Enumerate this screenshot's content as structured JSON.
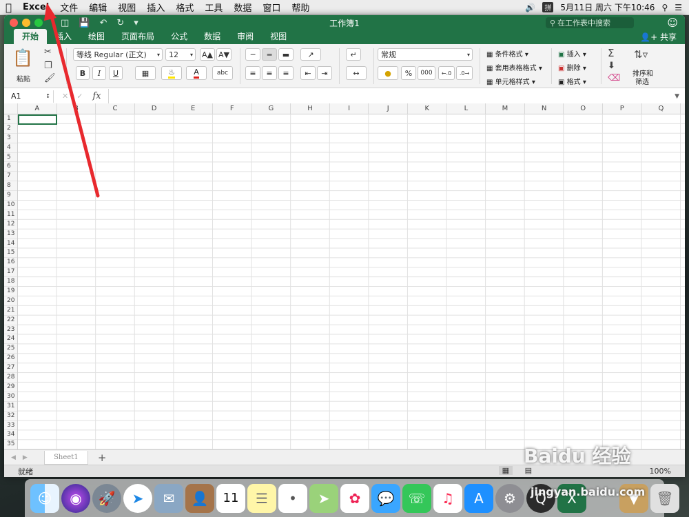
{
  "menubar": {
    "apple": "",
    "app": "Excel",
    "items": [
      "文件",
      "编辑",
      "视图",
      "插入",
      "格式",
      "工具",
      "数据",
      "窗口",
      "帮助"
    ],
    "datetime": "5月11日 周六 下午10:46"
  },
  "window": {
    "title": "工作簿1",
    "search_placeholder": "在工作表中搜索",
    "share": "共享"
  },
  "tabs": [
    "开始",
    "插入",
    "绘图",
    "页面布局",
    "公式",
    "数据",
    "审阅",
    "视图"
  ],
  "ribbon": {
    "paste": "粘贴",
    "font": "等线 Regular (正文)",
    "size": "12",
    "bold": "B",
    "italic": "I",
    "underline": "U",
    "number_format": "常规",
    "percent": "%",
    "thousands": "000",
    "cond_format": "条件格式",
    "table_format": "套用表格格式",
    "cell_style": "单元格样式",
    "insert": "插入",
    "delete": "删除",
    "format": "格式",
    "sort_filter_1": "排序和",
    "sort_filter_2": "筛选",
    "abc": "abc"
  },
  "formula": {
    "name_box": "A1",
    "fx": "fx"
  },
  "columns": [
    "A",
    "B",
    "C",
    "D",
    "E",
    "F",
    "G",
    "H",
    "I",
    "J",
    "K",
    "L",
    "M",
    "N",
    "O",
    "P",
    "Q"
  ],
  "rows": [
    "1",
    "2",
    "3",
    "4",
    "5",
    "6",
    "7",
    "8",
    "9",
    "10",
    "11",
    "12",
    "13",
    "14",
    "15",
    "16",
    "17",
    "18",
    "19",
    "20",
    "21",
    "22",
    "23",
    "24",
    "25",
    "26",
    "27",
    "28",
    "29",
    "30",
    "31",
    "32",
    "33",
    "34",
    "35"
  ],
  "sheet": {
    "tab": "Sheet1",
    "add": "+"
  },
  "status": {
    "ready": "就绪",
    "zoom": "100%"
  },
  "watermark": {
    "brand": "Baidu 经验",
    "url": "jingyan.baidu.com"
  },
  "colors": {
    "excel_green": "#217346",
    "arrow": "#e8292e"
  }
}
